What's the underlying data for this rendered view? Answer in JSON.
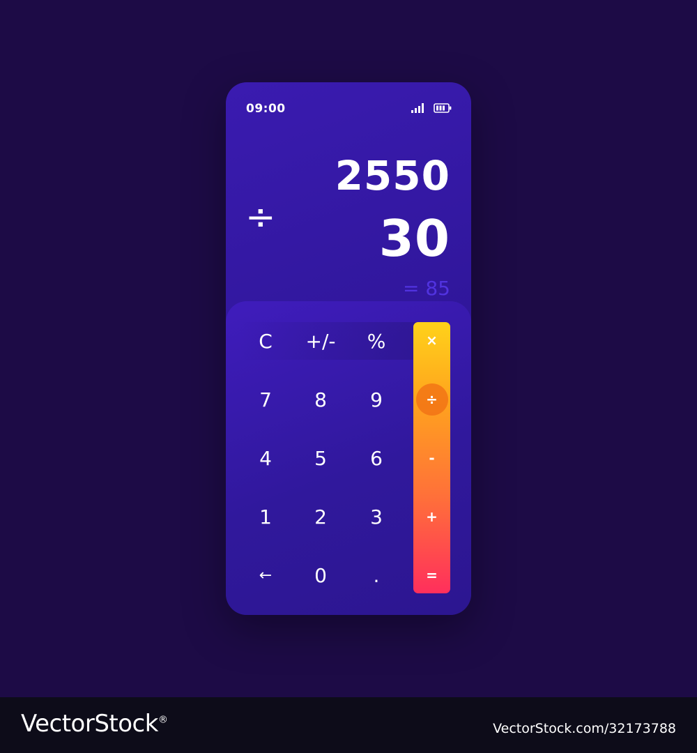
{
  "status": {
    "time": "09:00",
    "signal_icon": "signal-bars-icon",
    "battery_icon": "battery-icon"
  },
  "display": {
    "operator": "÷",
    "first_operand": "2550",
    "second_operand": "30",
    "result": "= 85"
  },
  "keypad": {
    "functions": [
      "C",
      "+/-",
      "%"
    ],
    "digits_row1": [
      "7",
      "8",
      "9"
    ],
    "digits_row2": [
      "4",
      "5",
      "6"
    ],
    "digits_row3": [
      "1",
      "2",
      "3"
    ],
    "digits_row4": [
      "←",
      "0",
      "."
    ],
    "operators": [
      "×",
      "÷",
      "-",
      "+",
      "="
    ],
    "active_operator": "÷"
  },
  "colors": {
    "background": "#1d0b46",
    "phone": "#3a1bb0",
    "result_text": "#5133e0",
    "operator_gradient_top": "#ffd21a",
    "operator_gradient_bottom": "#ff2f5c"
  },
  "footer": {
    "brand": "VectorStock",
    "registered_mark": "®",
    "image_id": "VectorStock.com/32173788"
  }
}
